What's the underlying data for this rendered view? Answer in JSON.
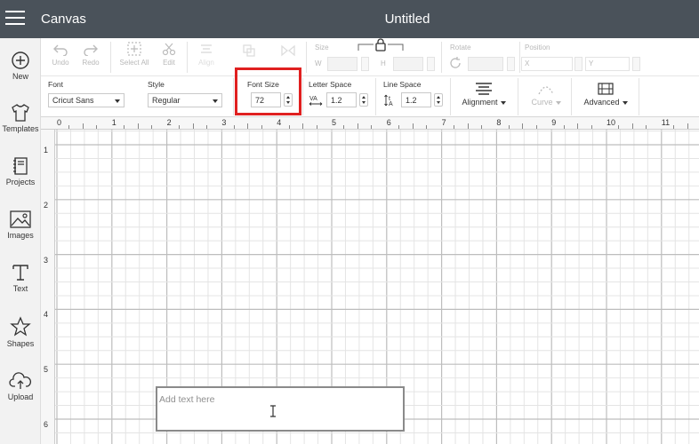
{
  "header": {
    "app_title": "Canvas",
    "doc_title": "Untitled"
  },
  "sidebar": {
    "items": [
      {
        "label": "New",
        "icon": "plus-circle-icon"
      },
      {
        "label": "Templates",
        "icon": "tshirt-icon"
      },
      {
        "label": "Projects",
        "icon": "book-icon"
      },
      {
        "label": "Images",
        "icon": "image-icon"
      },
      {
        "label": "Text",
        "icon": "text-t-icon"
      },
      {
        "label": "Shapes",
        "icon": "shapes-icon"
      },
      {
        "label": "Upload",
        "icon": "cloud-upload-icon"
      }
    ]
  },
  "toolbar1": {
    "undo": "Undo",
    "redo": "Redo",
    "select_all": "Select All",
    "edit": "Edit",
    "align": "Align",
    "size_label": "Size",
    "size_w": "W",
    "size_h": "H",
    "rotate_label": "Rotate",
    "position_label": "Position",
    "pos_x": "X",
    "pos_y": "Y"
  },
  "toolbar2": {
    "font_label": "Font",
    "font_value": "Cricut Sans",
    "style_label": "Style",
    "style_value": "Regular",
    "font_size_label": "Font Size",
    "font_size_value": "72",
    "letter_space_label": "Letter Space",
    "letter_space_value": "1.2",
    "line_space_label": "Line Space",
    "line_space_value": "1.2",
    "alignment_label": "Alignment",
    "curve_label": "Curve",
    "advanced_label": "Advanced",
    "highlight_color": "#e02020"
  },
  "rulers": {
    "top": [
      "0",
      "1",
      "2",
      "3",
      "4",
      "5",
      "6",
      "7",
      "8",
      "9",
      "10",
      "11"
    ],
    "left": [
      "1",
      "2",
      "3",
      "4",
      "5",
      "6"
    ]
  },
  "canvas": {
    "text_placeholder": "Add text here"
  }
}
